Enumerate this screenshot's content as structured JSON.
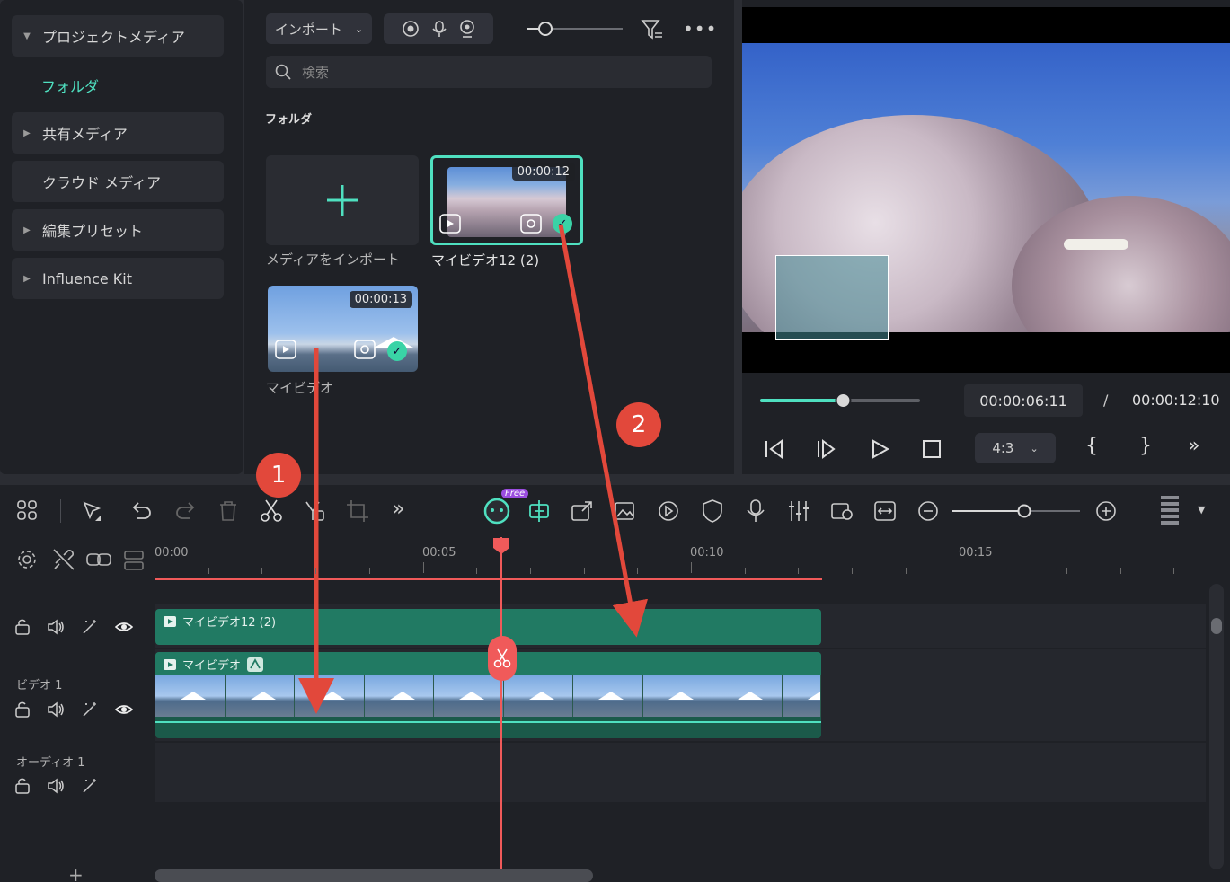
{
  "sidebar": {
    "project_media": "プロジェクトメディア",
    "folder": "フォルダ",
    "shared_media": "共有メディア",
    "cloud_media": "クラウド メディア",
    "edit_presets": "編集プリセット",
    "influence_kit": "Influence Kit"
  },
  "media": {
    "import_label": "インポート",
    "search_placeholder": "検索",
    "section": "フォルダ",
    "import_tile_caption": "メディアをインポート",
    "items": [
      {
        "name": "マイビデオ12 (2)",
        "duration": "00:00:12"
      },
      {
        "name": "マイビデオ",
        "duration": "00:00:13"
      }
    ]
  },
  "preview": {
    "current_time": "00:00:06:11",
    "separator": "/",
    "total_time": "00:00:12:10",
    "aspect": "4:3",
    "progress": 0.52,
    "brace_open": "{",
    "brace_close": "}"
  },
  "timeline": {
    "ai_badge": "Free",
    "ruler": [
      "00:00",
      "00:05",
      "00:10",
      "00:15"
    ],
    "tracks": [
      {
        "label": ""
      },
      {
        "label": "ビデオ 1"
      },
      {
        "label": "オーディオ 1"
      }
    ],
    "clips": [
      {
        "name": "マイビデオ12 (2)"
      },
      {
        "name": "マイビデオ"
      }
    ]
  },
  "annotations": [
    "1",
    "2"
  ],
  "colors": {
    "accent": "#4fe0c0",
    "clip": "#217a63",
    "playhead": "#f05a5a",
    "arrow": "#e2483b"
  }
}
